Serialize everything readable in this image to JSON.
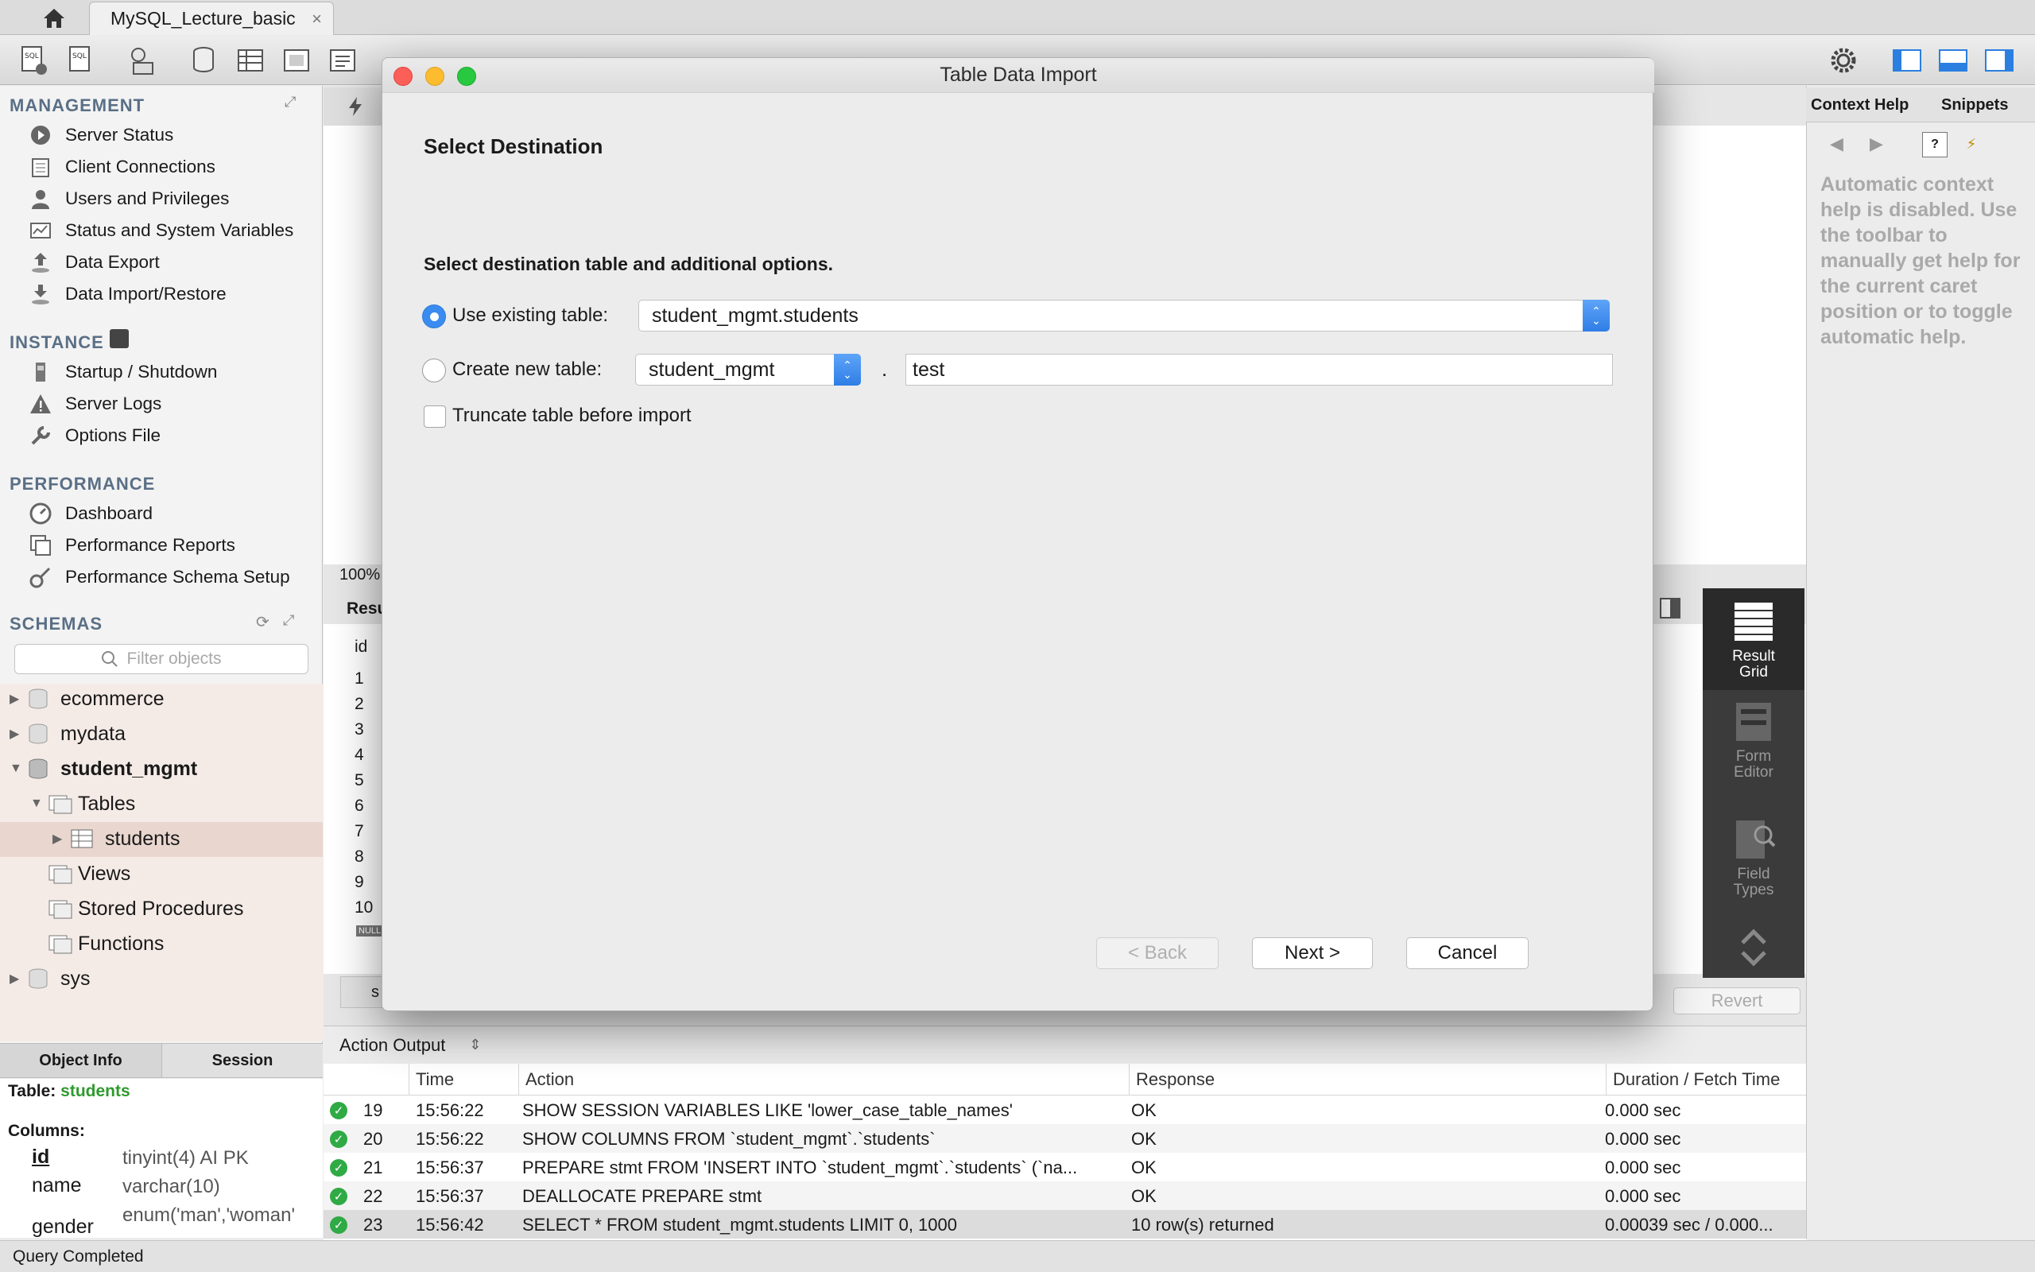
{
  "tab": {
    "title": "MySQL_Lecture_basic",
    "close": "×"
  },
  "sidebar": {
    "management_header": "MANAGEMENT",
    "management_items": [
      "Server Status",
      "Client Connections",
      "Users and Privileges",
      "Status and System Variables",
      "Data Export",
      "Data Import/Restore"
    ],
    "instance_header": "INSTANCE",
    "instance_items": [
      "Startup / Shutdown",
      "Server Logs",
      "Options File"
    ],
    "performance_header": "PERFORMANCE",
    "performance_items": [
      "Dashboard",
      "Performance Reports",
      "Performance Schema Setup"
    ],
    "schemas_header": "SCHEMAS",
    "filter_placeholder": "Filter objects",
    "schemas": {
      "s1": "ecommerce",
      "s2": "mydata",
      "s3": "student_mgmt",
      "tables": "Tables",
      "students": "students",
      "views": "Views",
      "procs": "Stored Procedures",
      "funcs": "Functions",
      "sys": "sys"
    }
  },
  "objinfo": {
    "tab_info": "Object Info",
    "tab_session": "Session",
    "table_label": "Table:",
    "table_name": "students",
    "columns_label": "Columns:",
    "columns": [
      {
        "name": "id",
        "type": "tinyint(4) AI PK"
      },
      {
        "name": "name",
        "type": "varchar(10)"
      },
      {
        "name": "gender",
        "type": "enum('man','woman'"
      }
    ]
  },
  "main": {
    "zoom": "100%",
    "result_tab": "Resu",
    "grid_header": "id",
    "row_numbers": [
      "1",
      "2",
      "3",
      "4",
      "5",
      "6",
      "7",
      "8",
      "9",
      "10"
    ],
    "null_badge": "NULL",
    "revert": "Revert",
    "sql_tab_stub": "s"
  },
  "right": {
    "tab_help": "Context Help",
    "tab_snippets": "Snippets",
    "help_text": "Automatic context help is disabled. Use the toolbar to manually get help for the current caret position or to toggle automatic help.",
    "view_result": "Result Grid",
    "view_form": "Form Editor",
    "view_field": "Field Types"
  },
  "output": {
    "header": "Action Output",
    "columns": [
      "Time",
      "Action",
      "Response",
      "Duration / Fetch Time"
    ],
    "rows": [
      {
        "n": "19",
        "time": "15:56:22",
        "action": "SHOW SESSION VARIABLES LIKE 'lower_case_table_names'",
        "response": "OK",
        "duration": "0.000 sec"
      },
      {
        "n": "20",
        "time": "15:56:22",
        "action": "SHOW COLUMNS FROM `student_mgmt`.`students`",
        "response": "OK",
        "duration": "0.000 sec"
      },
      {
        "n": "21",
        "time": "15:56:37",
        "action": "PREPARE stmt FROM 'INSERT INTO `student_mgmt`.`students` (`na...",
        "response": "OK",
        "duration": "0.000 sec"
      },
      {
        "n": "22",
        "time": "15:56:37",
        "action": "DEALLOCATE PREPARE stmt",
        "response": "OK",
        "duration": "0.000 sec"
      },
      {
        "n": "23",
        "time": "15:56:42",
        "action": "SELECT * FROM student_mgmt.students LIMIT 0, 1000",
        "response": "10 row(s) returned",
        "duration": "0.00039 sec / 0.000..."
      }
    ]
  },
  "status": "Query Completed",
  "dialog": {
    "title": "Table Data Import",
    "heading": "Select Destination",
    "instruction": "Select destination table and additional options.",
    "use_existing_label": "Use existing table:",
    "use_existing_value": "student_mgmt.students",
    "create_new_label": "Create new table:",
    "schema_value": "student_mgmt",
    "dot": ".",
    "new_table_value": "test",
    "truncate_label": "Truncate table before import",
    "back": "< Back",
    "next": "Next >",
    "cancel": "Cancel"
  },
  "colors": {
    "accent": "#3a8cf0",
    "ok": "#2faa45",
    "table_name": "#2f9a2f",
    "section": "#5a6f86"
  }
}
